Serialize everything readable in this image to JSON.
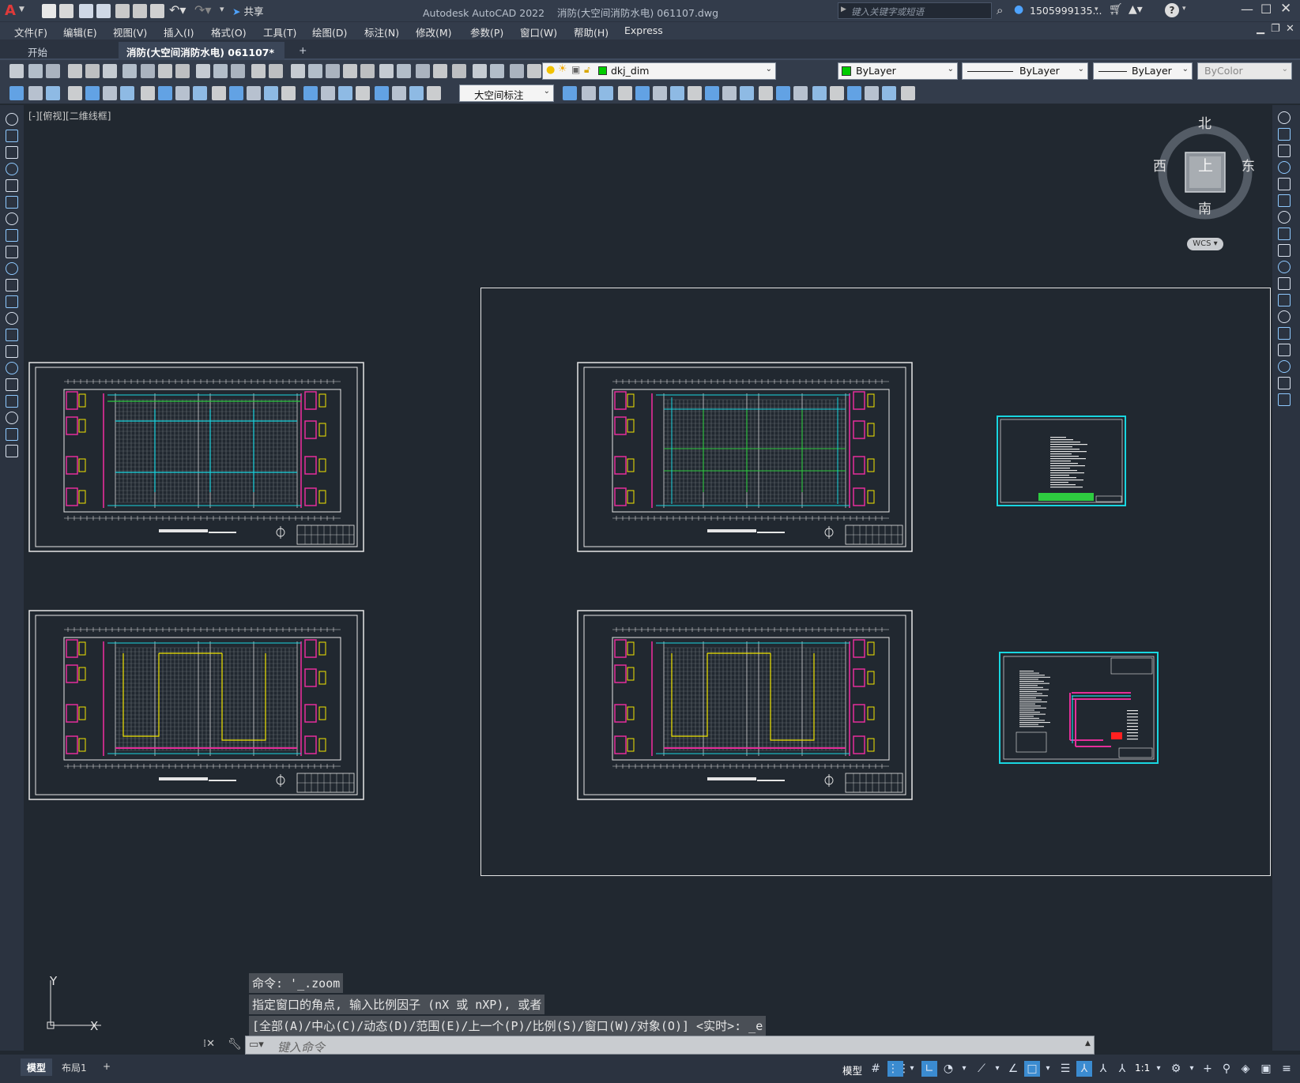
{
  "app": {
    "title": "Autodesk AutoCAD 2022",
    "document": "消防(大空间消防水电) 061107.dwg",
    "logo": "A"
  },
  "quick_access": {
    "share_label": "共享"
  },
  "search": {
    "placeholder": "键入关键字或短语"
  },
  "user": {
    "name": "1505999135..."
  },
  "menu": [
    "文件(F)",
    "编辑(E)",
    "视图(V)",
    "插入(I)",
    "格式(O)",
    "工具(T)",
    "绘图(D)",
    "标注(N)",
    "修改(M)",
    "参数(P)",
    "窗口(W)",
    "帮助(H)",
    "Express"
  ],
  "tabs": {
    "start": "开始",
    "active": "消防(大空间消防水电) 061107*",
    "close": "×",
    "new": "+"
  },
  "layer": {
    "current": "dkj_dim",
    "color": "#00cc00"
  },
  "properties": {
    "color": "ByLayer",
    "linetype": "ByLayer",
    "lineweight": "ByLayer",
    "plotstyle": "ByColor"
  },
  "dim_style": "大空间标注",
  "viewport_label": "[-][俯视][二维线框]",
  "viewcube": {
    "north": "北",
    "south": "南",
    "east": "东",
    "west": "西",
    "top": "上",
    "wcs": "WCS"
  },
  "ucs": {
    "x": "X",
    "y": "Y"
  },
  "command": {
    "history": [
      "命令: '_.zoom",
      "指定窗口的角点, 输入比例因子 (nX 或 nXP), 或者",
      "[全部(A)/中心(C)/动态(D)/范围(E)/上一个(P)/比例(S)/窗口(W)/对象(O)] <实时>: _e"
    ],
    "placeholder": "键入命令"
  },
  "layout_tabs": [
    "模型",
    "布局1"
  ],
  "status": {
    "model": "模型",
    "scale": "1:1"
  },
  "colors": {
    "bg": "#212830",
    "panel": "#333c4b",
    "accent": "#3b8bd0"
  }
}
